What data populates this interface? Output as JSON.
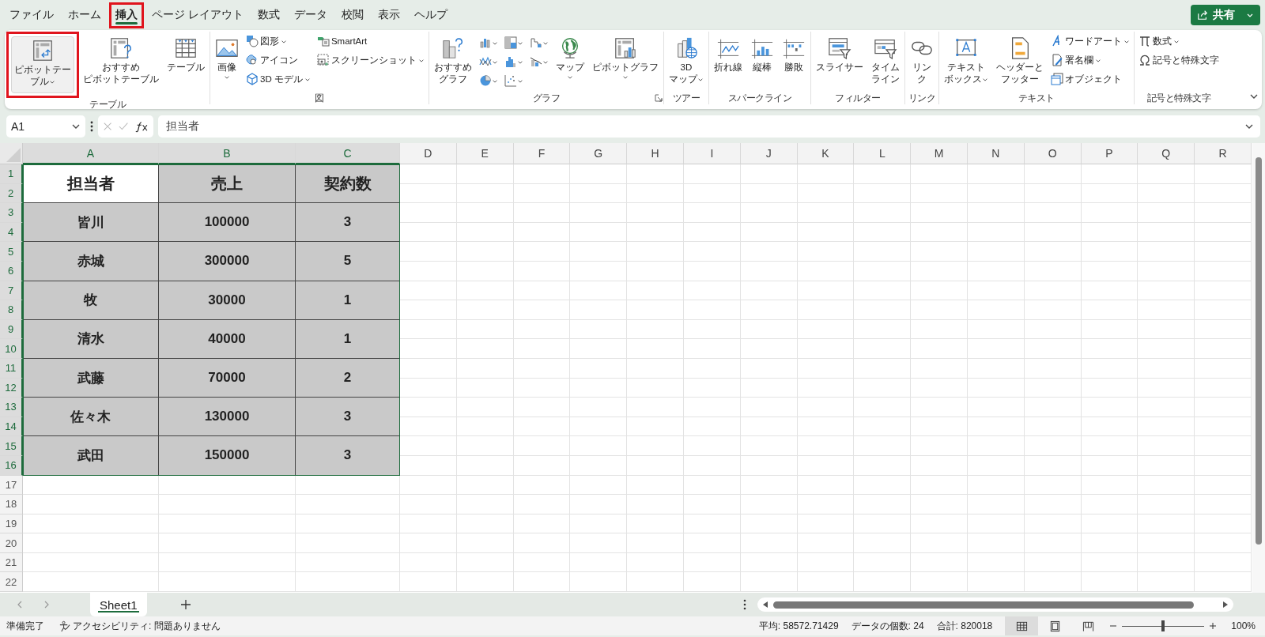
{
  "tabs": [
    {
      "label": "ファイル",
      "selected": false,
      "highlighted": false
    },
    {
      "label": "ホーム",
      "selected": false,
      "highlighted": false
    },
    {
      "label": "挿入",
      "selected": true,
      "highlighted": true
    },
    {
      "label": "ページ レイアウト",
      "selected": false,
      "highlighted": false
    },
    {
      "label": "数式",
      "selected": false,
      "highlighted": false
    },
    {
      "label": "データ",
      "selected": false,
      "highlighted": false
    },
    {
      "label": "校閲",
      "selected": false,
      "highlighted": false
    },
    {
      "label": "表示",
      "selected": false,
      "highlighted": false
    },
    {
      "label": "ヘルプ",
      "selected": false,
      "highlighted": false
    }
  ],
  "share_button": {
    "label": "共有"
  },
  "ribbon": {
    "groups": [
      {
        "label": "テーブル",
        "columns": [
          [
            {
              "kind": "large",
              "lines": [
                "ピボットテー",
                "ブル"
              ],
              "dropdown": true,
              "highlighted": true
            }
          ],
          [
            {
              "kind": "large",
              "lines": [
                "おすすめ",
                "ピボットテーブル"
              ],
              "dropdown": false,
              "highlighted": false
            }
          ],
          [
            {
              "kind": "large",
              "lines": [
                "テーブル"
              ],
              "dropdown": false,
              "highlighted": false
            }
          ]
        ]
      },
      {
        "label": "図",
        "columns": [
          [
            {
              "kind": "large",
              "lines": [
                "画像"
              ],
              "dropdown": true,
              "highlighted": false
            }
          ],
          [
            {
              "kind": "small",
              "lines": [
                "図形"
              ],
              "dropdown": true,
              "highlighted": false
            },
            {
              "kind": "small",
              "lines": [
                "アイコン"
              ],
              "dropdown": false,
              "highlighted": false
            },
            {
              "kind": "small",
              "lines": [
                "3D モデル"
              ],
              "dropdown": true,
              "highlighted": false
            }
          ],
          [
            {
              "kind": "small",
              "lines": [
                "SmartArt"
              ],
              "dropdown": false,
              "highlighted": false
            },
            {
              "kind": "small",
              "lines": [
                "スクリーンショット"
              ],
              "dropdown": true,
              "highlighted": false
            }
          ]
        ]
      },
      {
        "label": "グラフ",
        "launcher": true,
        "columns": [
          [
            {
              "kind": "large",
              "lines": [
                "おすすめ",
                "グラフ"
              ],
              "dropdown": false,
              "highlighted": false
            }
          ],
          [
            {
              "kind": "icon",
              "dropdown": true,
              "highlighted": false
            },
            {
              "kind": "icon",
              "dropdown": true,
              "highlighted": false
            },
            {
              "kind": "icon",
              "dropdown": true,
              "highlighted": false
            }
          ],
          [
            {
              "kind": "icon",
              "dropdown": true,
              "highlighted": false
            },
            {
              "kind": "icon",
              "dropdown": true,
              "highlighted": false
            },
            {
              "kind": "icon",
              "dropdown": true,
              "highlighted": false
            }
          ],
          [
            {
              "kind": "icon",
              "dropdown": true,
              "highlighted": false
            },
            {
              "kind": "icon",
              "dropdown": true,
              "highlighted": false
            }
          ],
          [
            {
              "kind": "large",
              "lines": [
                "マップ"
              ],
              "dropdown": true,
              "highlighted": false
            }
          ],
          [
            {
              "kind": "large",
              "lines": [
                "ピボットグラフ"
              ],
              "dropdown": true,
              "highlighted": false
            }
          ]
        ]
      },
      {
        "label": "ツアー",
        "columns": [
          [
            {
              "kind": "large",
              "lines": [
                "3D",
                "マップ"
              ],
              "dropdown": true,
              "highlighted": false
            }
          ]
        ]
      },
      {
        "label": "スパークライン",
        "columns": [
          [
            {
              "kind": "large",
              "lines": [
                "折れ線"
              ],
              "dropdown": false,
              "highlighted": false
            }
          ],
          [
            {
              "kind": "large",
              "lines": [
                "縦棒"
              ],
              "dropdown": false,
              "highlighted": false
            }
          ],
          [
            {
              "kind": "large",
              "lines": [
                "勝敗"
              ],
              "dropdown": false,
              "highlighted": false
            }
          ]
        ]
      },
      {
        "label": "フィルター",
        "columns": [
          [
            {
              "kind": "large",
              "lines": [
                "スライサー"
              ],
              "dropdown": false,
              "highlighted": false
            }
          ],
          [
            {
              "kind": "large",
              "lines": [
                "タイム",
                "ライン"
              ],
              "dropdown": false,
              "highlighted": false
            }
          ]
        ]
      },
      {
        "label": "リンク",
        "columns": [
          [
            {
              "kind": "large",
              "lines": [
                "リン",
                "ク"
              ],
              "dropdown": false,
              "highlighted": false
            }
          ]
        ]
      },
      {
        "label": "テキスト",
        "columns": [
          [
            {
              "kind": "large",
              "lines": [
                "テキスト",
                "ボックス"
              ],
              "dropdown": true,
              "highlighted": false
            }
          ],
          [
            {
              "kind": "large",
              "lines": [
                "ヘッダーと",
                "フッター"
              ],
              "dropdown": false,
              "highlighted": false
            }
          ],
          [
            {
              "kind": "small",
              "lines": [
                "ワードアート"
              ],
              "dropdown": true,
              "highlighted": false
            },
            {
              "kind": "small",
              "lines": [
                "署名欄"
              ],
              "dropdown": true,
              "highlighted": false
            },
            {
              "kind": "small",
              "lines": [
                "オブジェクト"
              ],
              "dropdown": false,
              "highlighted": false
            }
          ]
        ]
      },
      {
        "label": "記号と特殊文字",
        "columns": [
          [
            {
              "kind": "small",
              "lines": [
                "数式"
              ],
              "dropdown": true,
              "highlighted": false
            },
            {
              "kind": "small",
              "lines": [
                "記号と特殊文字"
              ],
              "dropdown": false,
              "highlighted": false
            }
          ]
        ]
      }
    ]
  },
  "formula_bar": {
    "name_box": "A1",
    "formula": "担当者"
  },
  "columns": [
    {
      "label": "A",
      "selected": true
    },
    {
      "label": "B",
      "selected": true
    },
    {
      "label": "C",
      "selected": true
    },
    {
      "label": "D",
      "selected": false
    },
    {
      "label": "E",
      "selected": false
    },
    {
      "label": "F",
      "selected": false
    },
    {
      "label": "G",
      "selected": false
    },
    {
      "label": "H",
      "selected": false
    },
    {
      "label": "I",
      "selected": false
    },
    {
      "label": "J",
      "selected": false
    },
    {
      "label": "K",
      "selected": false
    },
    {
      "label": "L",
      "selected": false
    },
    {
      "label": "M",
      "selected": false
    },
    {
      "label": "N",
      "selected": false
    },
    {
      "label": "O",
      "selected": false
    },
    {
      "label": "P",
      "selected": false
    },
    {
      "label": "Q",
      "selected": false
    },
    {
      "label": "R",
      "selected": false
    }
  ],
  "rows": [
    {
      "label": "1",
      "selected": true
    },
    {
      "label": "2",
      "selected": true
    },
    {
      "label": "3",
      "selected": true
    },
    {
      "label": "4",
      "selected": true
    },
    {
      "label": "5",
      "selected": true
    },
    {
      "label": "6",
      "selected": true
    },
    {
      "label": "7",
      "selected": true
    },
    {
      "label": "8",
      "selected": true
    },
    {
      "label": "9",
      "selected": true
    },
    {
      "label": "10",
      "selected": true
    },
    {
      "label": "11",
      "selected": true
    },
    {
      "label": "12",
      "selected": true
    },
    {
      "label": "13",
      "selected": true
    },
    {
      "label": "14",
      "selected": true
    },
    {
      "label": "15",
      "selected": true
    },
    {
      "label": "16",
      "selected": true
    },
    {
      "label": "17",
      "selected": false
    },
    {
      "label": "18",
      "selected": false
    },
    {
      "label": "19",
      "selected": false
    },
    {
      "label": "20",
      "selected": false
    },
    {
      "label": "21",
      "selected": false
    },
    {
      "label": "22",
      "selected": false
    }
  ],
  "table": {
    "header": [
      {
        "text": "担当者",
        "filled": false
      },
      {
        "text": "売上",
        "filled": true
      },
      {
        "text": "契約数",
        "filled": true
      }
    ],
    "rows": [
      [
        "皆川",
        "100000",
        "3"
      ],
      [
        "赤城",
        "300000",
        "5"
      ],
      [
        "牧",
        "30000",
        "1"
      ],
      [
        "清水",
        "40000",
        "1"
      ],
      [
        "武藤",
        "70000",
        "2"
      ],
      [
        "佐々木",
        "130000",
        "3"
      ],
      [
        "武田",
        "150000",
        "3"
      ]
    ]
  },
  "sheet_tabs": [
    {
      "label": "Sheet1",
      "selected": true
    }
  ],
  "status_bar": {
    "ready": "準備完了",
    "accessibility": "アクセシビリティ: 問題ありません",
    "stats": [
      "平均: 58572.71429",
      "データの個数: 24",
      "合計: 820018"
    ],
    "views": [
      {
        "selected": true
      },
      {
        "selected": false
      },
      {
        "selected": false
      }
    ],
    "zoom": {
      "level": 0.5,
      "label": "100%"
    }
  }
}
